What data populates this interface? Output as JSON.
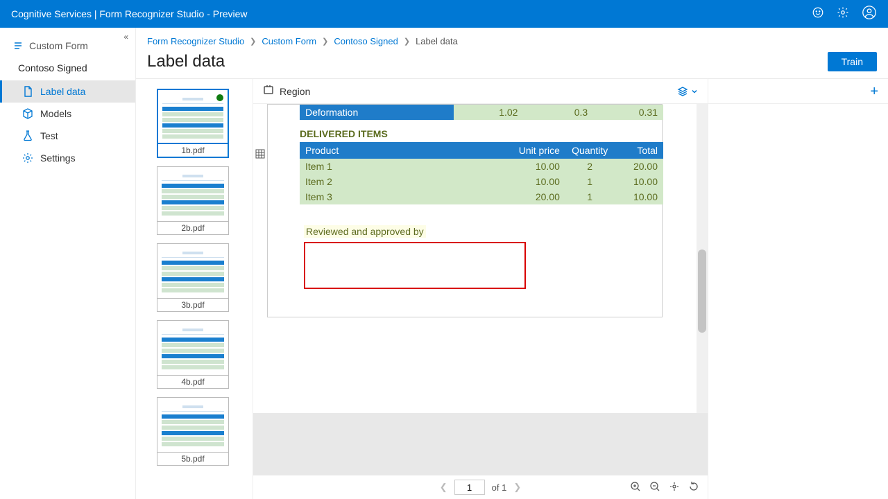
{
  "topbar": {
    "title": "Cognitive Services | Form Recognizer Studio - Preview"
  },
  "sidebar": {
    "back_label": "Custom Form",
    "project_name": "Contoso Signed",
    "items": [
      {
        "label": "Label data",
        "active": true
      },
      {
        "label": "Models"
      },
      {
        "label": "Test"
      },
      {
        "label": "Settings"
      }
    ]
  },
  "breadcrumb": [
    {
      "label": "Form Recognizer Studio",
      "link": true
    },
    {
      "label": "Custom Form",
      "link": true
    },
    {
      "label": "Contoso Signed",
      "link": true
    },
    {
      "label": "Label data",
      "link": false
    }
  ],
  "page_title": "Label data",
  "train_label": "Train",
  "thumbnails": [
    {
      "name": "1b.pdf",
      "selected": true,
      "labeled": true
    },
    {
      "name": "2b.pdf"
    },
    {
      "name": "3b.pdf"
    },
    {
      "name": "4b.pdf"
    },
    {
      "name": "5b.pdf"
    }
  ],
  "canvas_toolbar": {
    "region": "Region"
  },
  "document": {
    "partial_row": {
      "c0": "Deformation",
      "c1": "1.02",
      "c2": "0.3",
      "c3": "0.31"
    },
    "delivered_title": "DELIVERED ITEMS",
    "headers": {
      "product": "Product",
      "unit_price": "Unit price",
      "quantity": "Quantity",
      "total": "Total"
    },
    "rows": [
      {
        "product": "Item 1",
        "unit_price": "10.00",
        "quantity": "2",
        "total": "20.00"
      },
      {
        "product": "Item 2",
        "unit_price": "10.00",
        "quantity": "1",
        "total": "10.00"
      },
      {
        "product": "Item 3",
        "unit_price": "20.00",
        "quantity": "1",
        "total": "10.00"
      }
    ],
    "reviewed_label": "Reviewed and approved by"
  },
  "pager": {
    "current": "1",
    "total_text": "of 1"
  }
}
